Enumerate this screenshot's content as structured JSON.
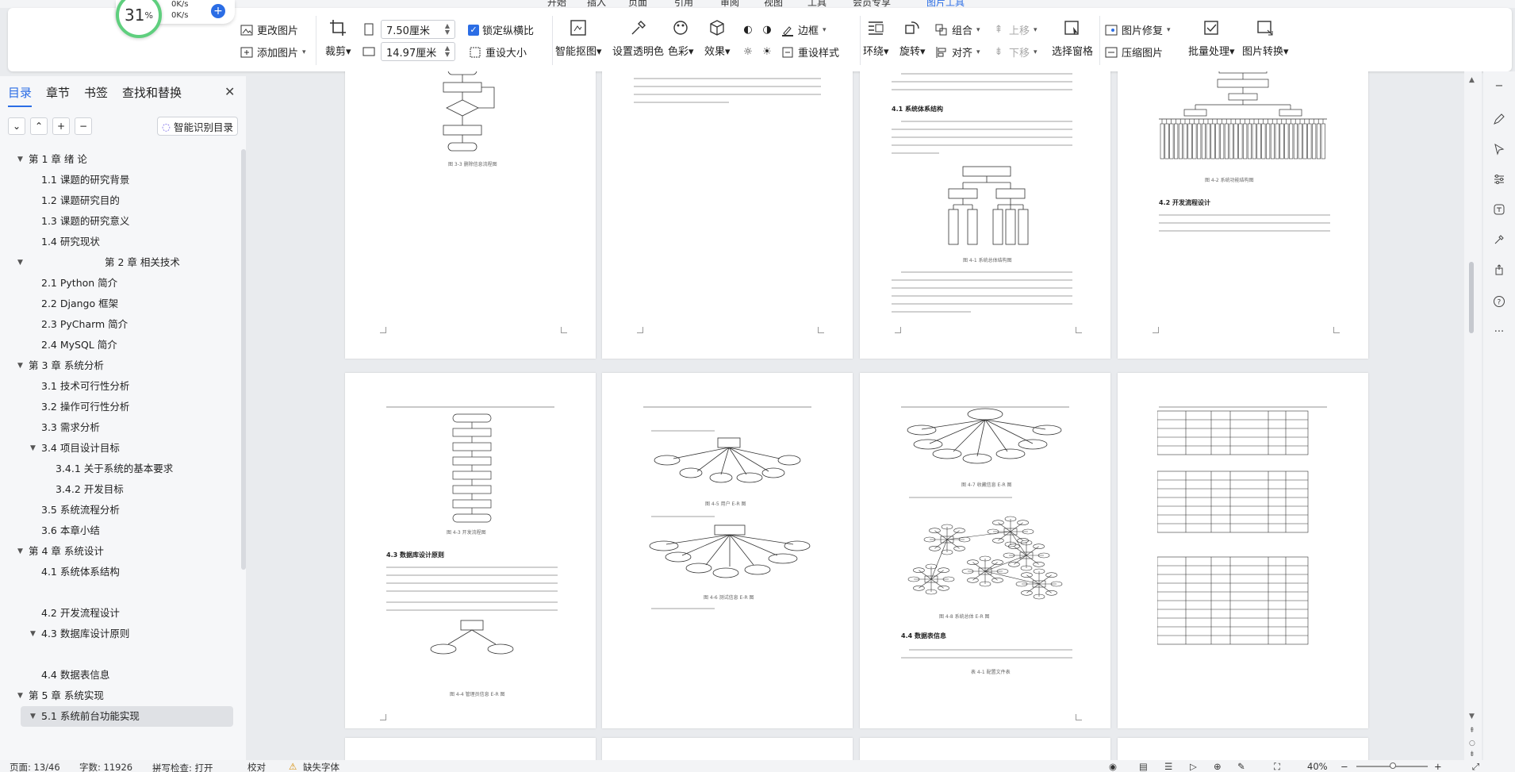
{
  "top_menu": {
    "items": [
      "开始",
      "插入",
      "页面",
      "引用",
      "审阅",
      "视图",
      "工具",
      "会员专享",
      "图片工具"
    ],
    "active": "图片工具"
  },
  "speed": {
    "percent": "31",
    "percent_unit": "%",
    "up": "0K/s",
    "down": "0K/s"
  },
  "ribbon": {
    "change_picture": "更改图片",
    "add_picture": "添加图片",
    "crop": "裁剪",
    "width_value": "7.50厘米",
    "height_value": "14.97厘米",
    "lock_ratio": "锁定纵横比",
    "reset_size": "重设大小",
    "smart_cutout": "智能抠图",
    "set_transparent": "设置透明色",
    "color": "色彩",
    "effects": "效果",
    "border": "边框",
    "reset_style": "重设样式",
    "wrap": "环绕",
    "rotate": "旋转",
    "group": "组合",
    "align": "对齐",
    "bring_up": "上移",
    "send_down": "下移",
    "selection_pane": "选择窗格",
    "picture_repair": "图片修复",
    "compress": "压缩图片",
    "batch": "批量处理",
    "convert": "图片转换"
  },
  "panel": {
    "tabs": [
      "目录",
      "章节",
      "书签",
      "查找和替换"
    ],
    "smart_toc": "智能识别目录",
    "toc": [
      {
        "label": "第 1 章   绪   论",
        "level": 1,
        "arrow": true
      },
      {
        "label": "1.1   课题的研究背景",
        "level": 2
      },
      {
        "label": "1.2   课题研究目的",
        "level": 2
      },
      {
        "label": "1.3   课题的研究意义",
        "level": 2
      },
      {
        "label": "1.4   研究现状",
        "level": 2
      },
      {
        "label": "第 2 章   相关技术",
        "level": 0,
        "arrow": true
      },
      {
        "label": "2.1   Python 简介",
        "level": 2
      },
      {
        "label": "2.2   Django 框架",
        "level": 2
      },
      {
        "label": "2.3 PyCharm 简介",
        "level": 2
      },
      {
        "label": "2.4 MySQL 简介",
        "level": 2
      },
      {
        "label": "第 3 章   系统分析",
        "level": 1,
        "arrow": true
      },
      {
        "label": "3.1   技术可行性分析",
        "level": 2
      },
      {
        "label": "3.2   操作可行性分析",
        "level": 2
      },
      {
        "label": "3.3   需求分析",
        "level": 2
      },
      {
        "label": "3.4   项目设计目标",
        "level": 2,
        "arrow": true
      },
      {
        "label": "3.4.1  关于系统的基本要求",
        "level": 3
      },
      {
        "label": "3.4.2 开发目标",
        "level": 3
      },
      {
        "label": "3.5   系统流程分析",
        "level": 2
      },
      {
        "label": "3.6   本章小结",
        "level": 2
      },
      {
        "label": "第 4 章   系统设计",
        "level": 1,
        "arrow": true
      },
      {
        "label": "4.1   系统体系结构",
        "level": 2
      },
      {
        "label": "",
        "level": 2
      },
      {
        "label": "4.2   开发流程设计",
        "level": 2
      },
      {
        "label": "4.3   数据库设计原则",
        "level": 2,
        "arrow": true
      },
      {
        "label": "",
        "level": 2
      },
      {
        "label": "4.4   数据表信息",
        "level": 2
      },
      {
        "label": "第 5 章   系统实现",
        "level": 1,
        "arrow": true
      },
      {
        "label": "5.1 系统前台功能实现",
        "level": 2,
        "arrow": true,
        "selected": true
      }
    ]
  },
  "pages_text": {
    "p3_heading": "4.1  系统体系结构",
    "p4_heading": "4.2  开发流程设计",
    "p5_heading": "4.3  数据库设计原则",
    "p7_heading": "4.4  数据表信息"
  },
  "status": {
    "page": "页面: 13/46",
    "words": "字数: 11926",
    "spell": "拼写检查: 打开",
    "proof": "校对",
    "missing_font": "缺失字体",
    "zoom": "40%"
  }
}
